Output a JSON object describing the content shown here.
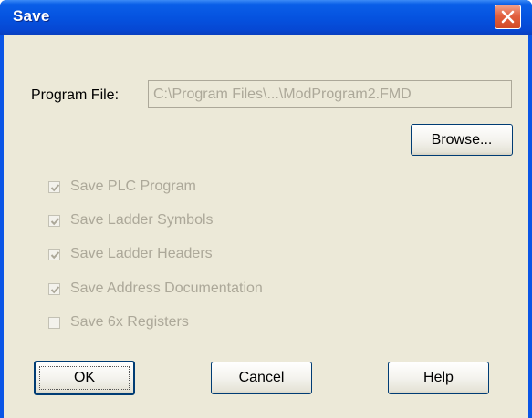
{
  "window": {
    "title": "Save"
  },
  "program_file": {
    "label": "Program File:",
    "value": "C:\\Program Files\\...\\ModProgram2.FMD"
  },
  "buttons": {
    "browse": "Browse...",
    "ok": "OK",
    "cancel": "Cancel",
    "help": "Help"
  },
  "options": [
    {
      "label": "Save PLC Program",
      "checked": true,
      "enabled": false
    },
    {
      "label": "Save Ladder Symbols",
      "checked": true,
      "enabled": false
    },
    {
      "label": "Save Ladder Headers",
      "checked": true,
      "enabled": false
    },
    {
      "label": "Save Address Documentation",
      "checked": true,
      "enabled": false
    },
    {
      "label": "Save 6x Registers",
      "checked": false,
      "enabled": false
    }
  ],
  "colors": {
    "titlebar": "#0553e0",
    "client": "#ece9d8",
    "disabled_text": "#aca899",
    "close_button": "#e2603e"
  },
  "icons": {
    "close": "close-icon",
    "check": "checkmark-icon"
  }
}
